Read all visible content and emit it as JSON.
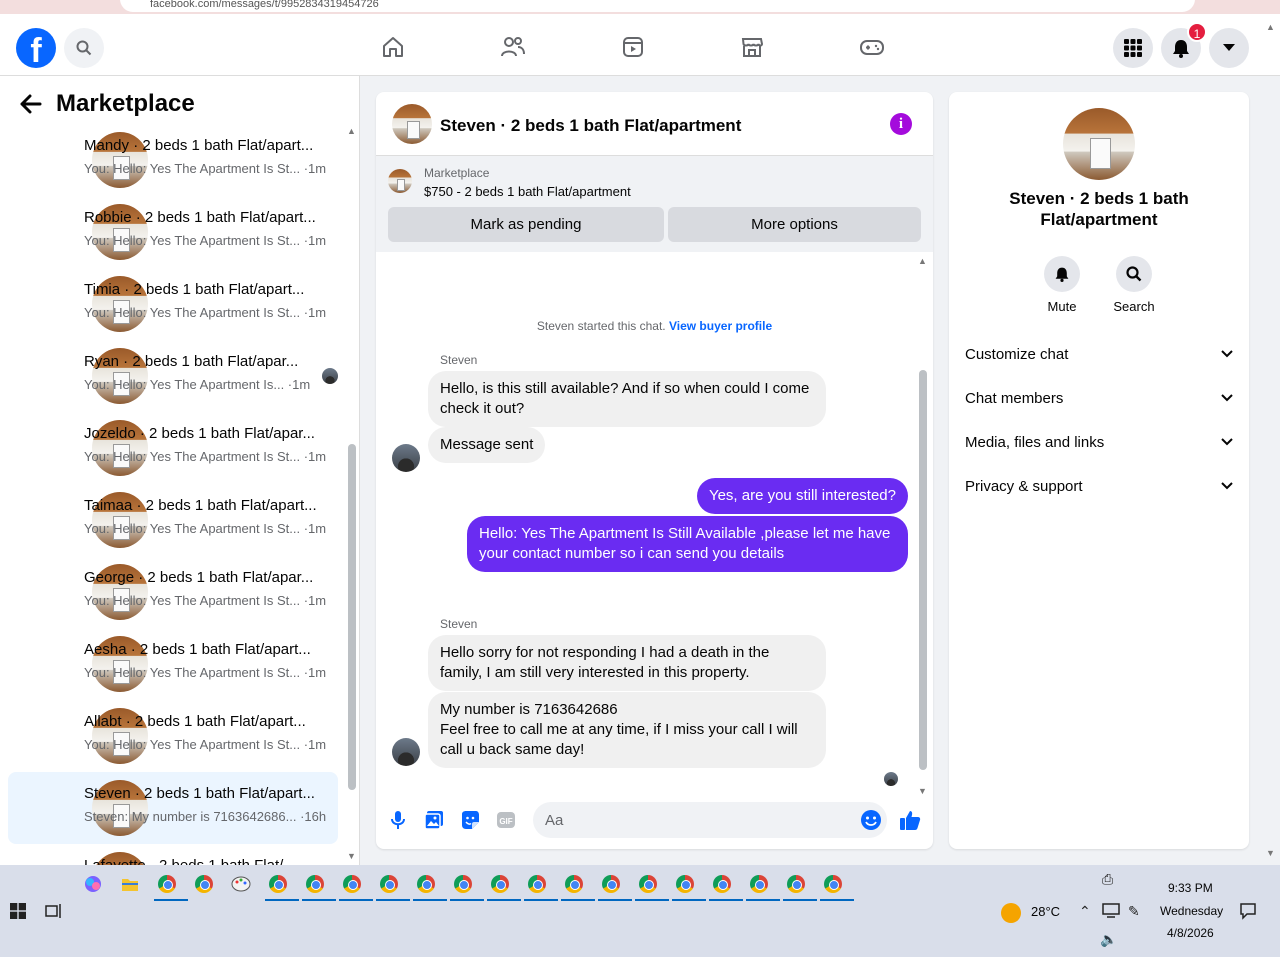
{
  "browser": {
    "url": "facebook.com/messages/t/9952834319454726"
  },
  "nav": {
    "notification_count": "1"
  },
  "sidebar": {
    "title": "Marketplace",
    "conversations": [
      {
        "name": "Mandy · 2 beds 1 bath Flat/apart...",
        "preview": "You: Hello: Yes The Apartment Is St... ·1m"
      },
      {
        "name": "Robbie · 2 beds 1 bath Flat/apart...",
        "preview": "You: Hello: Yes The Apartment Is St... ·1m"
      },
      {
        "name": "Timia · 2 beds 1 bath Flat/apart...",
        "preview": "You: Hello: Yes The Apartment Is St... ·1m"
      },
      {
        "name": "Ryan · 2 beds 1 bath Flat/apar...",
        "preview": "You: Hello: Yes The Apartment Is... ·1m"
      },
      {
        "name": "Jozeldo · 2 beds 1 bath Flat/apar...",
        "preview": "You: Hello: Yes The Apartment Is St... ·1m"
      },
      {
        "name": "Taimaa · 2 beds 1 bath Flat/apart...",
        "preview": "You: Hello: Yes The Apartment Is St... ·1m"
      },
      {
        "name": "George · 2 beds 1 bath Flat/apar...",
        "preview": "You: Hello: Yes The Apartment Is St... ·1m"
      },
      {
        "name": "Aesha · 2 beds 1 bath Flat/apart...",
        "preview": "You: Hello: Yes The Apartment Is St... ·1m"
      },
      {
        "name": "Allabt · 2 beds 1 bath Flat/apart...",
        "preview": "You: Hello: Yes The Apartment Is St... ·1m"
      },
      {
        "name": "Steven · 2 beds 1 bath Flat/apart...",
        "preview": "Steven: My number is 7163642686... ·16h"
      },
      {
        "name": "Lafayette · 2 beds 1 bath Flat/...",
        "preview": ""
      }
    ]
  },
  "chat": {
    "title": "Steven · 2 beds 1 bath Flat/apartment",
    "marketplace_label": "Marketplace",
    "listing": "$750 - 2 beds 1 bath Flat/apartment",
    "mark_pending_label": "Mark as pending",
    "more_options_label": "More options",
    "system_text": "Steven started this chat.",
    "system_link": "View buyer profile",
    "sender_1": "Steven",
    "msg_1": "Hello, is this still available? And if so when could I come check it out?",
    "msg_2": "Message sent",
    "msg_3": "Yes, are you still interested?",
    "msg_4": "Hello: Yes The Apartment Is Still Available ,please let me have your contact number so i can send you details",
    "sender_2": "Steven",
    "msg_5": "Hello sorry for not responding I had a death in the family, I am still very interested in this property.",
    "msg_6_line1": "My number is 7163642686",
    "msg_6_line2": "Feel free to call me at any time, if I miss your call I will call u back same day!",
    "composer_placeholder": "Aa"
  },
  "info": {
    "name": "Steven · 2 beds 1 bath Flat/apartment",
    "mute_label": "Mute",
    "search_label": "Search",
    "sections": [
      "Customize chat",
      "Chat members",
      "Media, files and links",
      "Privacy & support"
    ]
  },
  "taskbar": {
    "temperature": "28°C",
    "time": "9:33 PM",
    "day": "Wednesday",
    "date": "4/8/2026"
  },
  "colors": {
    "brand": "#0866ff",
    "outgoing": "#6a2cf2",
    "info": "#a40bdc"
  }
}
